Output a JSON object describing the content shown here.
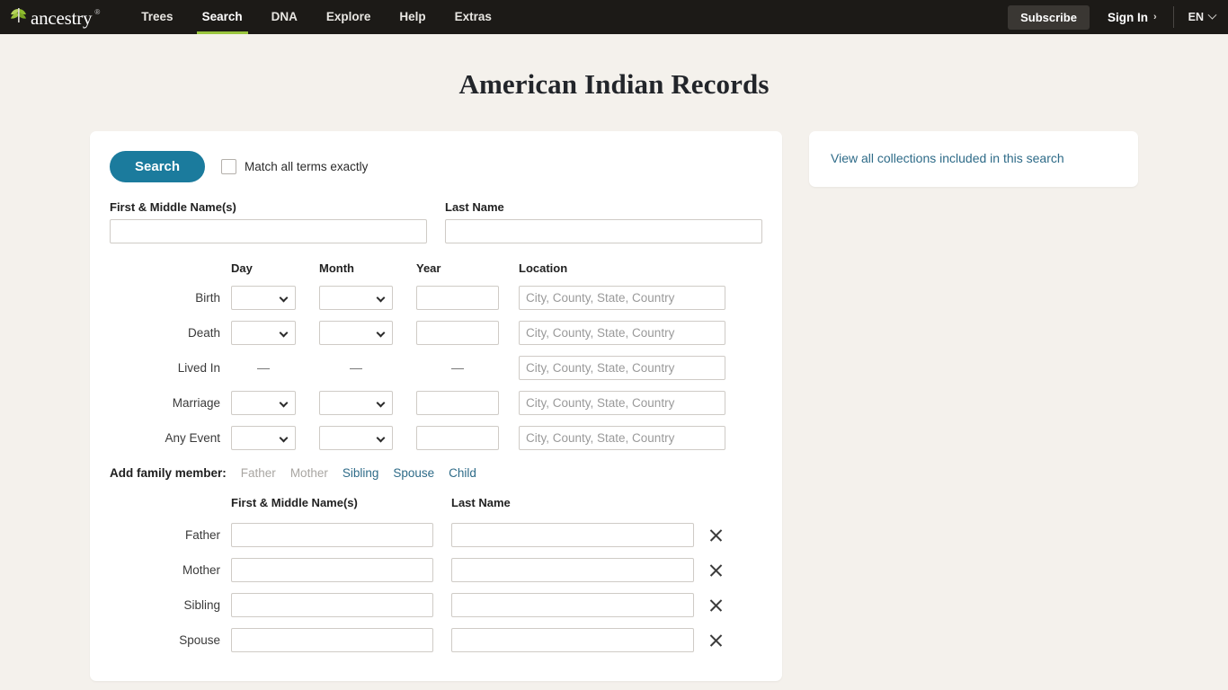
{
  "nav": {
    "logo_text": "ancestry",
    "logo_tm": "®",
    "links": [
      {
        "label": "Trees",
        "active": false
      },
      {
        "label": "Search",
        "active": true
      },
      {
        "label": "DNA",
        "active": false
      },
      {
        "label": "Explore",
        "active": false
      },
      {
        "label": "Help",
        "active": false
      },
      {
        "label": "Extras",
        "active": false
      }
    ],
    "subscribe_label": "Subscribe",
    "signin_label": "Sign In",
    "signin_chevron": "›",
    "language_label": "EN",
    "accent_green": "#9ac53e",
    "bar_background": "#1c1a17"
  },
  "page": {
    "title": "American Indian Records",
    "background": "#f4f1ec"
  },
  "search": {
    "search_button_label": "Search",
    "search_button_color": "#1b7b9d",
    "match_exactly_label": "Match all terms exactly",
    "match_exactly_checked": false,
    "name_headers": {
      "first_middle": "First & Middle Name(s)",
      "last": "Last Name"
    },
    "first_name_value": "",
    "last_name_value": "",
    "grid_headers": {
      "day": "Day",
      "month": "Month",
      "year": "Year",
      "location": "Location"
    },
    "location_placeholder": "City, County, State, Country",
    "rows": [
      {
        "label": "Birth",
        "has_selects": true,
        "day": "",
        "month": "",
        "year": "",
        "location": ""
      },
      {
        "label": "Death",
        "has_selects": true,
        "day": "",
        "month": "",
        "year": "",
        "location": ""
      },
      {
        "label": "Lived In",
        "has_selects": false,
        "dash": "—",
        "location": ""
      },
      {
        "label": "Marriage",
        "has_selects": true,
        "day": "",
        "month": "",
        "year": "",
        "location": ""
      },
      {
        "label": "Any Event",
        "has_selects": true,
        "day": "",
        "month": "",
        "year": "",
        "location": ""
      }
    ]
  },
  "family": {
    "add_label": "Add family member:",
    "add_links": [
      {
        "label": "Father",
        "disabled": true
      },
      {
        "label": "Mother",
        "disabled": true
      },
      {
        "label": "Sibling",
        "disabled": false
      },
      {
        "label": "Spouse",
        "disabled": false
      },
      {
        "label": "Child",
        "disabled": false
      }
    ],
    "headers": {
      "first_middle": "First & Middle Name(s)",
      "last": "Last Name"
    },
    "rows": [
      {
        "label": "Father",
        "first": "",
        "last": ""
      },
      {
        "label": "Mother",
        "first": "",
        "last": ""
      },
      {
        "label": "Sibling",
        "first": "",
        "last": ""
      },
      {
        "label": "Spouse",
        "first": "",
        "last": ""
      }
    ],
    "remove_icon": "×",
    "link_color": "#2e6b88"
  },
  "sidebar": {
    "collections_link": "View all collections included in this search"
  }
}
